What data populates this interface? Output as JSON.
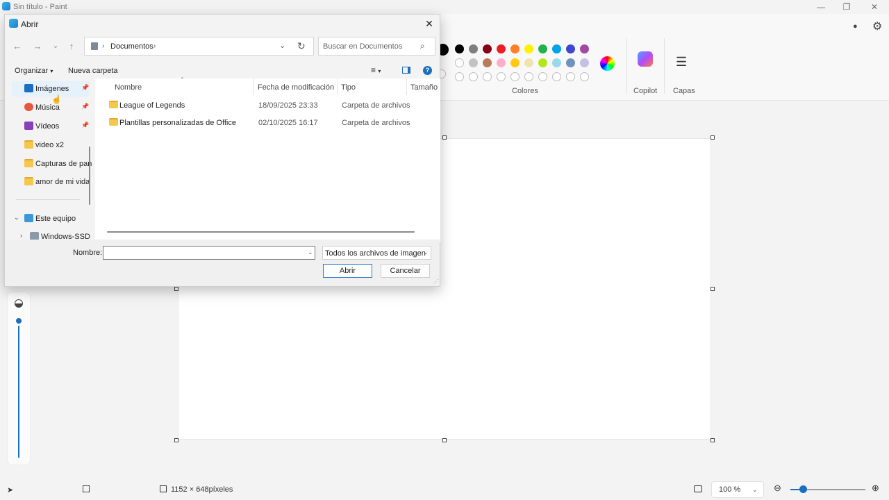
{
  "app": {
    "title": "Sin título - Paint",
    "colors_label": "Colores",
    "copilot_label": "Copilot",
    "layers_label": "Capas",
    "canvas_size": "1152 × 648píxeles",
    "zoom": "100 %",
    "palette_row1": [
      "#000000",
      "#7f7f7f",
      "#880015",
      "#ed1c24",
      "#ff7f27",
      "#fff200",
      "#22b14c",
      "#00a2e8",
      "#3f48cc",
      "#a349a4"
    ],
    "palette_row2": [
      "#ffffff",
      "#c3c3c3",
      "#b97a57",
      "#ffaec9",
      "#ffc90e",
      "#efe4b0",
      "#b5e61d",
      "#99d9ea",
      "#7092be",
      "#c8bfe7"
    ]
  },
  "dialog": {
    "title": "Abrir",
    "breadcrumb": "Documentos",
    "search_placeholder": "Buscar en Documentos",
    "organize_label": "Organizar",
    "new_folder_label": "Nueva carpeta",
    "nav_items": [
      {
        "label": "Imágenes",
        "pinned": true
      },
      {
        "label": "Música",
        "pinned": true
      },
      {
        "label": "Vídeos",
        "pinned": true
      },
      {
        "label": "video x2",
        "pinned": false
      },
      {
        "label": "Capturas de pan",
        "pinned": false
      },
      {
        "label": "amor de mi vida",
        "pinned": false
      }
    ],
    "this_pc": "Este equipo",
    "drive": "Windows-SSD",
    "columns": {
      "name": "Nombre",
      "modified": "Fecha de modificación",
      "type": "Tipo",
      "size": "Tamaño"
    },
    "rows": [
      {
        "name": "League of Legends",
        "modified": "18/09/2025 23:33",
        "type": "Carpeta de archivos"
      },
      {
        "name": "Plantillas personalizadas de Office",
        "modified": "02/10/2025 16:17",
        "type": "Carpeta de archivos"
      }
    ],
    "filename_label": "Nombre:",
    "filename_value": "",
    "filter_value": "Todos los archivos de imagen",
    "open_button": "Abrir",
    "cancel_button": "Cancelar"
  }
}
